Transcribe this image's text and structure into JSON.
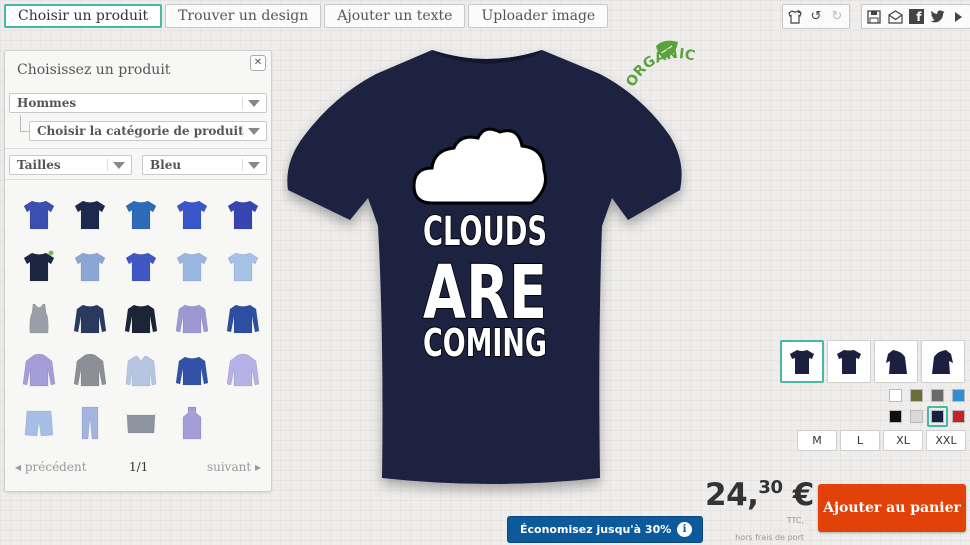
{
  "tabs": [
    {
      "label": "Choisir un produit",
      "active": true
    },
    {
      "label": "Trouver un design"
    },
    {
      "label": "Ajouter un texte"
    },
    {
      "label": "Uploader image"
    }
  ],
  "toolbar_left": [
    {
      "icon": "shirt-star-icon"
    },
    {
      "icon": "undo-icon"
    },
    {
      "icon": "redo-icon",
      "disabled": true
    }
  ],
  "toolbar_right": [
    {
      "icon": "save-icon"
    },
    {
      "icon": "email-icon"
    },
    {
      "icon": "facebook-icon",
      "text": "f"
    },
    {
      "icon": "twitter-icon"
    },
    {
      "icon": "play-icon"
    }
  ],
  "panel": {
    "title": "Choisissez un produit",
    "gender": "Hommes",
    "category": "Choisir la catégorie de produit",
    "sizes_filter": "Tailles",
    "color_filter": "Bleu",
    "products": [
      {
        "type": "tshirt",
        "color": "#3a4fb0"
      },
      {
        "type": "tshirt",
        "color": "#1d2a4e"
      },
      {
        "type": "tshirt",
        "color": "#2d6ab8"
      },
      {
        "type": "tshirt",
        "color": "#3856c8"
      },
      {
        "type": "tshirt",
        "color": "#3546b0"
      },
      {
        "type": "tshirt",
        "color": "#1d2640",
        "badge": true
      },
      {
        "type": "tshirt",
        "color": "#8aa6d6"
      },
      {
        "type": "tshirt",
        "color": "#4056c2"
      },
      {
        "type": "tshirt",
        "color": "#9ab7e2"
      },
      {
        "type": "tshirt",
        "color": "#a6c1e6"
      },
      {
        "type": "tank",
        "color": "#9a9ea6"
      },
      {
        "type": "longsleeve",
        "color": "#2a3a5e"
      },
      {
        "type": "longsleeve",
        "color": "#1c2436"
      },
      {
        "type": "longsleeve",
        "color": "#9d98d2"
      },
      {
        "type": "longsleeve",
        "color": "#2d4fa2"
      },
      {
        "type": "hoodie",
        "color": "#a59dd8"
      },
      {
        "type": "hoodie",
        "color": "#8c8f96"
      },
      {
        "type": "jacket",
        "color": "#b6c6e2"
      },
      {
        "type": "longsleeve",
        "color": "#3252a8"
      },
      {
        "type": "hoodie",
        "color": "#b4b2e6"
      },
      {
        "type": "shorts",
        "color": "#a6bee6"
      },
      {
        "type": "pants",
        "color": "#a4b4e0"
      },
      {
        "type": "apron-short",
        "color": "#8e93a0"
      },
      {
        "type": "apron",
        "color": "#a39dd8"
      }
    ],
    "pager": {
      "prev": "précédent",
      "page": "1/1",
      "next": "suivant"
    }
  },
  "design": {
    "line1": "CLOUDS",
    "line2": "ARE",
    "line3": "COMING",
    "organic": "ORGANIC"
  },
  "colors": {
    "shirt": "#1b2040",
    "accent": "#46b8a3",
    "cart": "#e2410a",
    "promo": "#0c5a9c"
  },
  "views": [
    {
      "name": "front",
      "active": true
    },
    {
      "name": "back"
    },
    {
      "name": "sleeve-left"
    },
    {
      "name": "sleeve-right"
    }
  ],
  "swatches": [
    {
      "color": "#ffffff"
    },
    {
      "color": "#6b6e3a"
    },
    {
      "color": "#6a6a6a"
    },
    {
      "color": "#2f8fd0"
    },
    {
      "color": "#111111"
    },
    {
      "color": "#d8d8d8"
    },
    {
      "color": "#1b2040",
      "active": true
    },
    {
      "color": "#c4232a"
    }
  ],
  "size_options": [
    "M",
    "L",
    "XL",
    "XXL"
  ],
  "price": {
    "main": "24,",
    "cents": "30",
    "currency": " €",
    "ttc": "TTC,",
    "shipping": "hors frais de port"
  },
  "cart_label": "Ajouter au panier",
  "promo": {
    "label": "Économisez jusqu'à 30%",
    "info": "i"
  }
}
